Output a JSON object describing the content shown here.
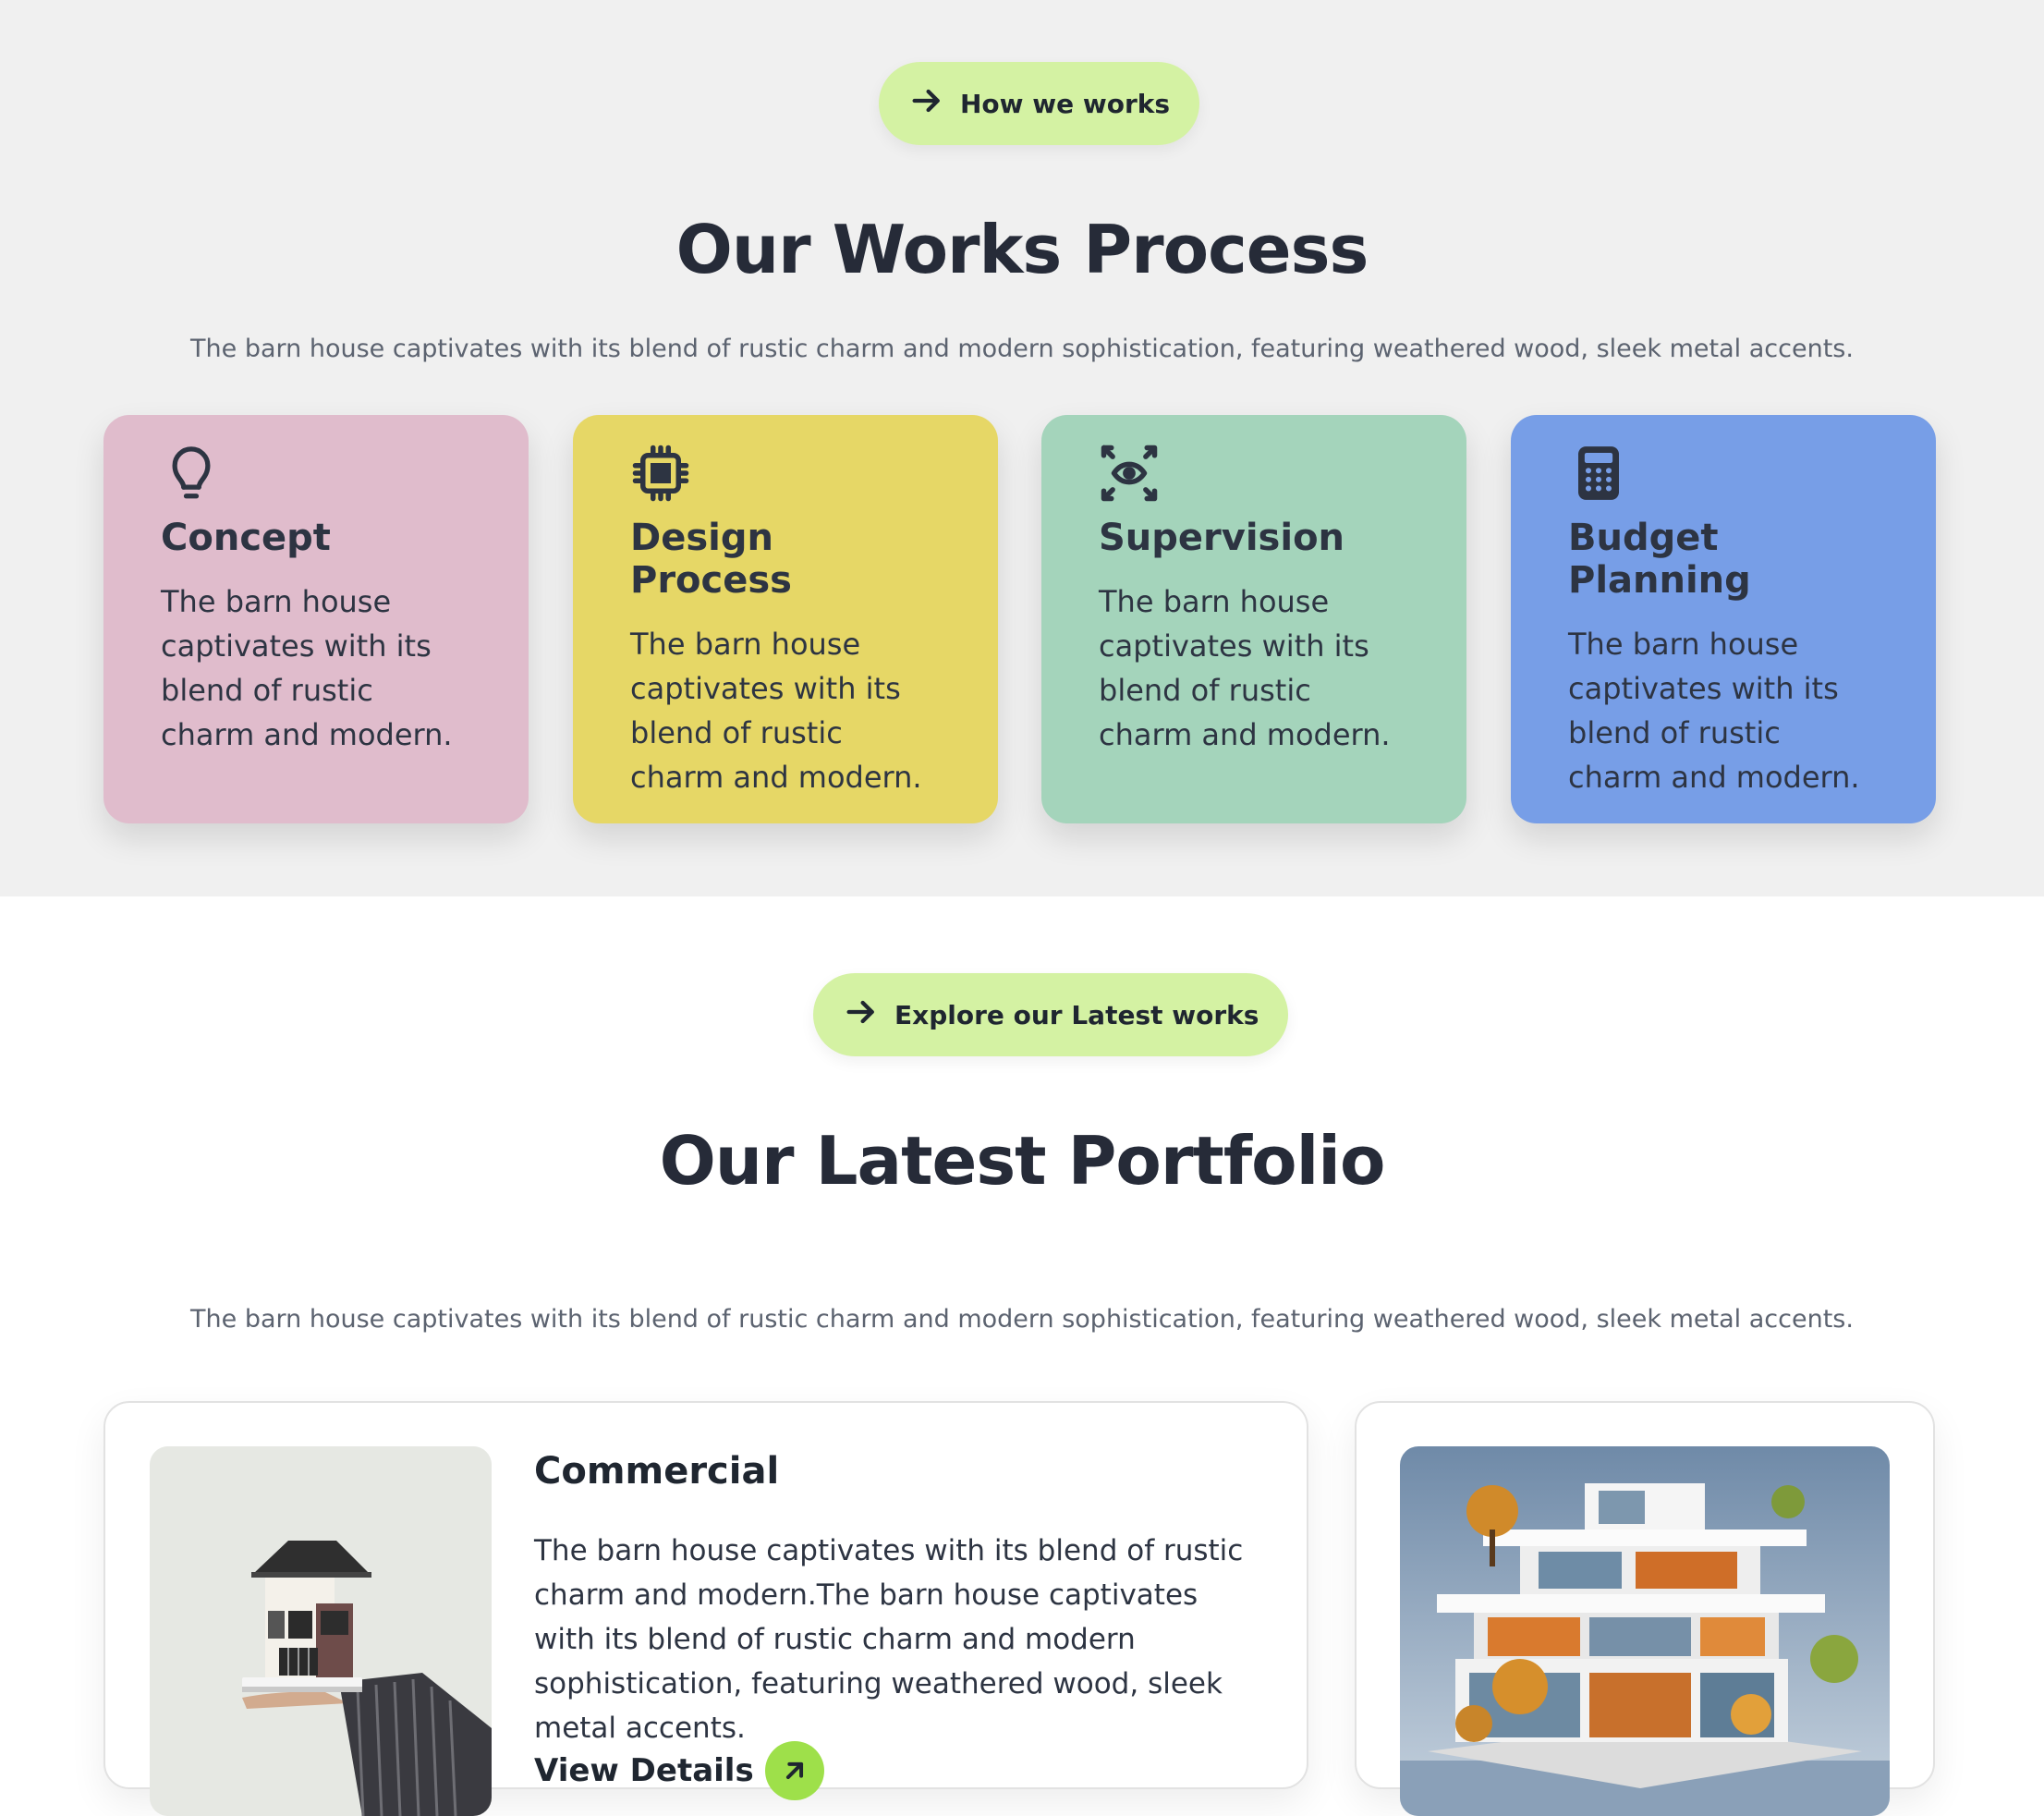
{
  "process": {
    "pill_label": "How we works",
    "title": "Our Works Process",
    "subtitle": "The barn house captivates with its blend of rustic charm and modern sophistication, featuring weathered wood, sleek metal accents.",
    "cards": [
      {
        "title": "Concept",
        "text": "The barn house captivates with its blend of rustic charm and modern.",
        "color": "#e0bccc",
        "icon": "lightbulb-icon"
      },
      {
        "title": "Design Process",
        "text": "The barn house captivates with its blend of rustic charm and modern.",
        "color": "#e6d766",
        "icon": "chip-icon"
      },
      {
        "title": "Supervision",
        "text": "The barn house captivates with its blend of rustic charm and modern.",
        "color": "#a4d4bb",
        "icon": "eye-focus-icon"
      },
      {
        "title": "Budget Planning",
        "text": "The barn house captivates with its blend of rustic charm and modern.",
        "color": "#779ee7",
        "icon": "calculator-icon"
      }
    ]
  },
  "portfolio": {
    "pill_label": "Explore our Latest works",
    "title": "Our Latest Portfolio",
    "subtitle": "The barn house captivates with its blend of rustic charm and modern sophistication, featuring weathered wood, sleek metal accents.",
    "items": [
      {
        "title": "Commercial",
        "text": "The barn house captivates with its blend of rustic charm and modern.The barn house captivates with its blend of rustic charm and modern sophistication, featuring weathered wood, sleek metal accents.",
        "link_label": "View Details"
      }
    ]
  },
  "colors": {
    "accent_pill": "#d4f2a3",
    "link_circle": "#9ee04a"
  }
}
